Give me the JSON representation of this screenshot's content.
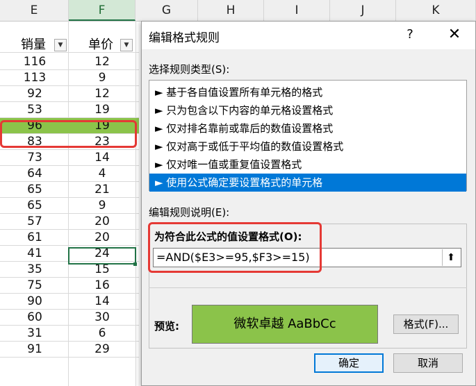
{
  "columns": [
    "E",
    "F",
    "G",
    "H",
    "I",
    "J",
    "K"
  ],
  "table": {
    "header_qty": "销量",
    "header_price": "单价",
    "filter_icon": "filter-dropdown-icon",
    "rows": [
      {
        "qty": "116",
        "price": "12"
      },
      {
        "qty": "113",
        "price": "9"
      },
      {
        "qty": "92",
        "price": "12"
      },
      {
        "qty": "53",
        "price": "19"
      },
      {
        "qty": "96",
        "price": "19"
      },
      {
        "qty": "83",
        "price": "23"
      },
      {
        "qty": "73",
        "price": "14"
      },
      {
        "qty": "64",
        "price": "4"
      },
      {
        "qty": "65",
        "price": "21"
      },
      {
        "qty": "65",
        "price": "9"
      },
      {
        "qty": "57",
        "price": "20"
      },
      {
        "qty": "61",
        "price": "20"
      },
      {
        "qty": "41",
        "price": "24"
      },
      {
        "qty": "35",
        "price": "15"
      },
      {
        "qty": "75",
        "price": "16"
      },
      {
        "qty": "90",
        "price": "14"
      },
      {
        "qty": "60",
        "price": "30"
      },
      {
        "qty": "31",
        "price": "6"
      },
      {
        "qty": "91",
        "price": "29"
      }
    ],
    "highlight_color": "#8bc34a"
  },
  "dialog": {
    "title": "编辑格式规则",
    "help": "?",
    "close": "✕",
    "select_rule_type_label": "选择规则类型(S):",
    "rule_types": [
      "► 基于各自值设置所有单元格的格式",
      "► 只为包含以下内容的单元格设置格式",
      "► 仅对排名靠前或靠后的数值设置格式",
      "► 仅对高于或低于平均值的数值设置格式",
      "► 仅对唯一值或重复值设置格式",
      "► 使用公式确定要设置格式的单元格"
    ],
    "edit_desc_label": "编辑规则说明(E):",
    "formula_label": "为符合此公式的值设置格式(O):",
    "formula_value": "=AND($E3>=95,$F3>=15)",
    "collapse_icon": "collapse-dialog-icon",
    "preview_label": "预览:",
    "preview_text": "微软卓越  AaBbCc",
    "format_button": "格式(F)...",
    "ok_button": "确定",
    "cancel_button": "取消",
    "accent_color": "#0078d7",
    "annotation_color": "#e53935"
  }
}
